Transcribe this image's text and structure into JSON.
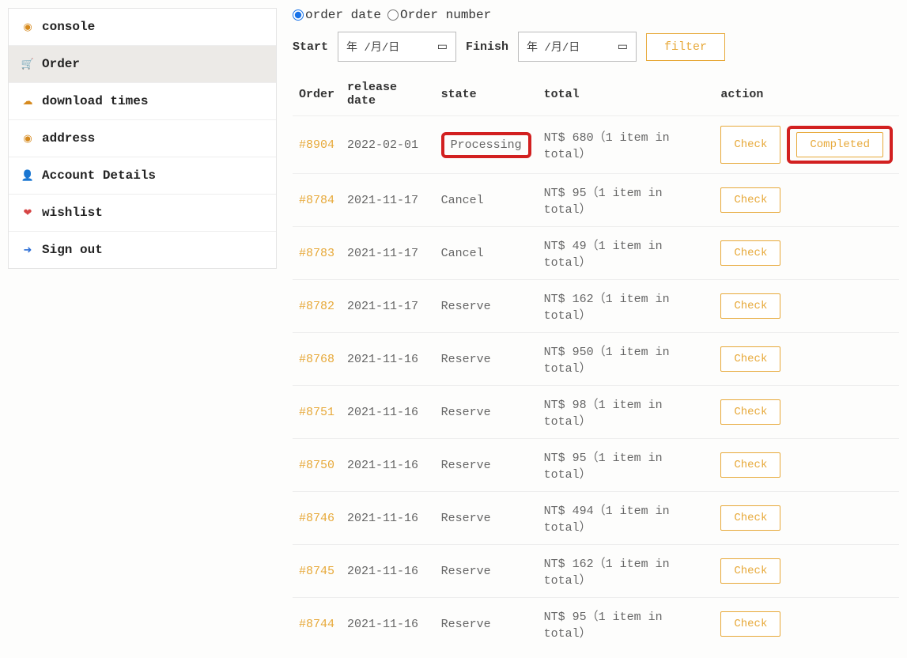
{
  "sidebar": {
    "items": [
      {
        "label": "console",
        "icon": "dashboard-icon",
        "glyph": "◉",
        "cls": "ic-orange",
        "active": false,
        "name": "sidebar-item-console"
      },
      {
        "label": "Order",
        "icon": "cart-icon",
        "glyph": "🛒",
        "cls": "ic-orange",
        "active": true,
        "name": "sidebar-item-order"
      },
      {
        "label": "download times",
        "icon": "download-icon",
        "glyph": "☁",
        "cls": "ic-orange",
        "active": false,
        "name": "sidebar-item-download-times"
      },
      {
        "label": "address",
        "icon": "pin-icon",
        "glyph": "◉",
        "cls": "ic-orange",
        "active": false,
        "name": "sidebar-item-address"
      },
      {
        "label": "Account Details",
        "icon": "user-icon",
        "glyph": "👤",
        "cls": "ic-orange",
        "active": false,
        "name": "sidebar-item-account-details"
      },
      {
        "label": "wishlist",
        "icon": "heart-icon",
        "glyph": "❤",
        "cls": "ic-red",
        "active": false,
        "name": "sidebar-item-wishlist"
      },
      {
        "label": "Sign out",
        "icon": "signout-icon",
        "glyph": "➜",
        "cls": "ic-blue",
        "active": false,
        "name": "sidebar-item-sign-out"
      }
    ]
  },
  "filter": {
    "radio_order_date": "order date",
    "radio_order_number": "Order number",
    "selected_radio": "order_date",
    "start_label": "Start",
    "finish_label": "Finish",
    "date_placeholder": "年 /月/日",
    "filter_button": "filter"
  },
  "table": {
    "headers": {
      "order": "Order",
      "release_date": "release date",
      "state": "state",
      "total": "total",
      "action": "action"
    },
    "rows": [
      {
        "order": "#8904",
        "date": "2022-02-01",
        "state": "Processing",
        "state_hl": true,
        "total": "NT$ 680（1 item in total）",
        "actions": [
          "Check",
          "Completed"
        ],
        "actions_hl": [
          false,
          true
        ]
      },
      {
        "order": "#8784",
        "date": "2021-11-17",
        "state": "Cancel",
        "state_hl": false,
        "total": "NT$ 95（1 item in total）",
        "actions": [
          "Check"
        ],
        "actions_hl": [
          false
        ]
      },
      {
        "order": "#8783",
        "date": "2021-11-17",
        "state": "Cancel",
        "state_hl": false,
        "total": "NT$ 49（1 item in total）",
        "actions": [
          "Check"
        ],
        "actions_hl": [
          false
        ]
      },
      {
        "order": "#8782",
        "date": "2021-11-17",
        "state": "Reserve",
        "state_hl": false,
        "total": "NT$ 162（1 item in total）",
        "actions": [
          "Check"
        ],
        "actions_hl": [
          false
        ]
      },
      {
        "order": "#8768",
        "date": "2021-11-16",
        "state": "Reserve",
        "state_hl": false,
        "total": "NT$ 950（1 item in total）",
        "actions": [
          "Check"
        ],
        "actions_hl": [
          false
        ]
      },
      {
        "order": "#8751",
        "date": "2021-11-16",
        "state": "Reserve",
        "state_hl": false,
        "total": "NT$ 98（1 item in total）",
        "actions": [
          "Check"
        ],
        "actions_hl": [
          false
        ]
      },
      {
        "order": "#8750",
        "date": "2021-11-16",
        "state": "Reserve",
        "state_hl": false,
        "total": "NT$ 95（1 item in total）",
        "actions": [
          "Check"
        ],
        "actions_hl": [
          false
        ]
      },
      {
        "order": "#8746",
        "date": "2021-11-16",
        "state": "Reserve",
        "state_hl": false,
        "total": "NT$ 494（1 item in total）",
        "actions": [
          "Check"
        ],
        "actions_hl": [
          false
        ]
      },
      {
        "order": "#8745",
        "date": "2021-11-16",
        "state": "Reserve",
        "state_hl": false,
        "total": "NT$ 162（1 item in total）",
        "actions": [
          "Check"
        ],
        "actions_hl": [
          false
        ]
      },
      {
        "order": "#8744",
        "date": "2021-11-16",
        "state": "Reserve",
        "state_hl": false,
        "total": "NT$ 95（1 item in total）",
        "actions": [
          "Check"
        ],
        "actions_hl": [
          false
        ]
      }
    ]
  }
}
